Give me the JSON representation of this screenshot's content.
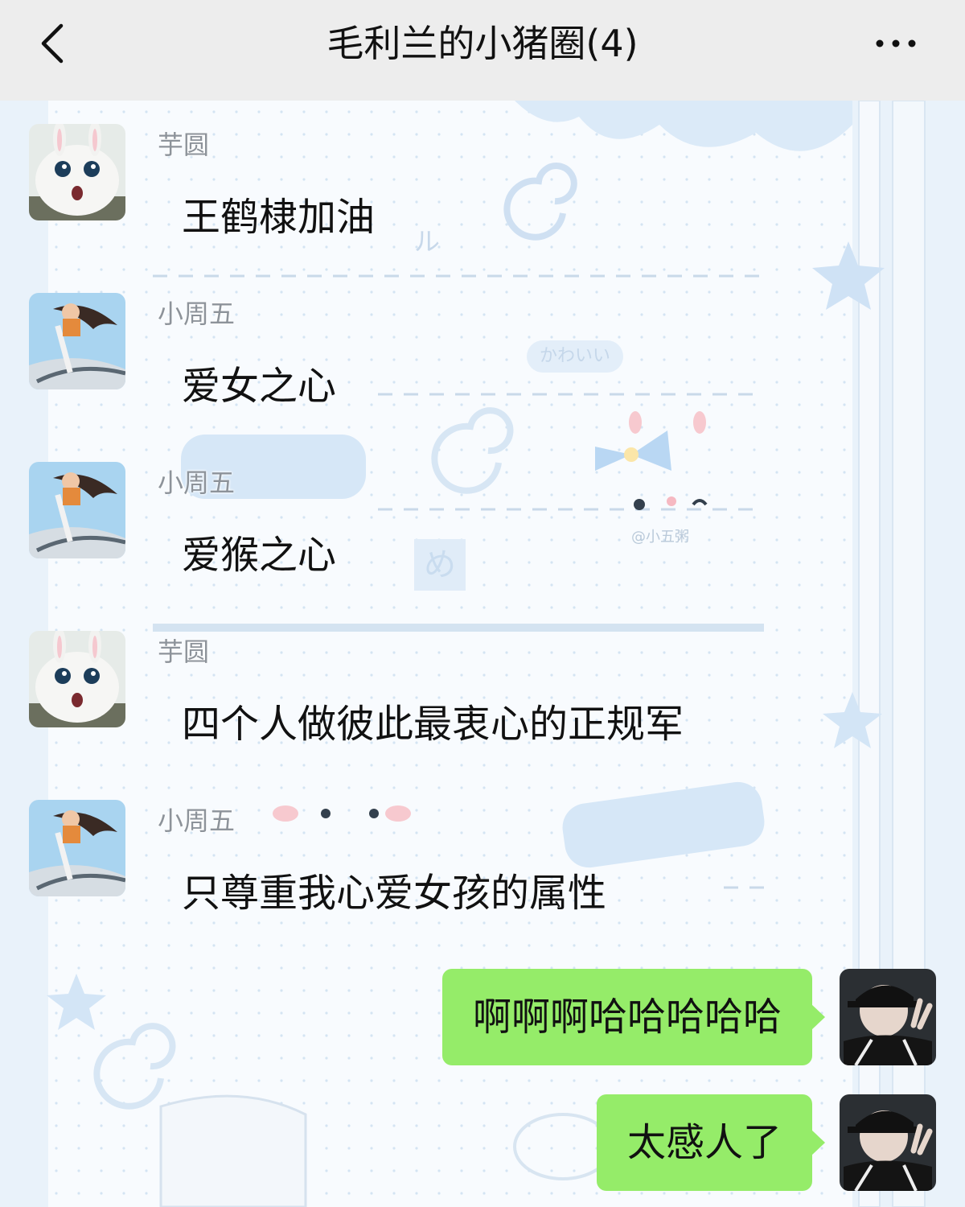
{
  "header": {
    "title": "毛利兰的小猪圈(4)",
    "back_icon": "chevron-left-icon",
    "more_icon": "ellipsis-icon"
  },
  "background": {
    "deco_1": "ル",
    "deco_2": "かわいい",
    "deco_3": "め",
    "deco_4": "@小五粥"
  },
  "messages": [
    {
      "sender": "芋圆",
      "text": "王鹤棣加油",
      "side": "left",
      "avatar": "bunny-avatar"
    },
    {
      "sender": "小周五",
      "text": "爱女之心",
      "side": "left",
      "avatar": "anime-avatar"
    },
    {
      "sender": "小周五",
      "text": "爱猴之心",
      "side": "left",
      "avatar": "anime-avatar"
    },
    {
      "sender": "芋圆",
      "text": "四个人做彼此最衷心的正规军",
      "side": "left",
      "avatar": "bunny-avatar"
    },
    {
      "sender": "小周五",
      "text": "只尊重我心爱女孩的属性",
      "side": "left",
      "avatar": "anime-avatar"
    },
    {
      "text": "啊啊啊哈哈哈哈哈",
      "side": "right",
      "avatar": "self-avatar"
    },
    {
      "text": "太感人了",
      "side": "right",
      "avatar": "self-avatar"
    }
  ],
  "colors": {
    "header_bg": "#ededed",
    "bubble_green": "#95ec69",
    "sender_gray": "#8d939a",
    "chat_bg": "#eaf3fb"
  }
}
